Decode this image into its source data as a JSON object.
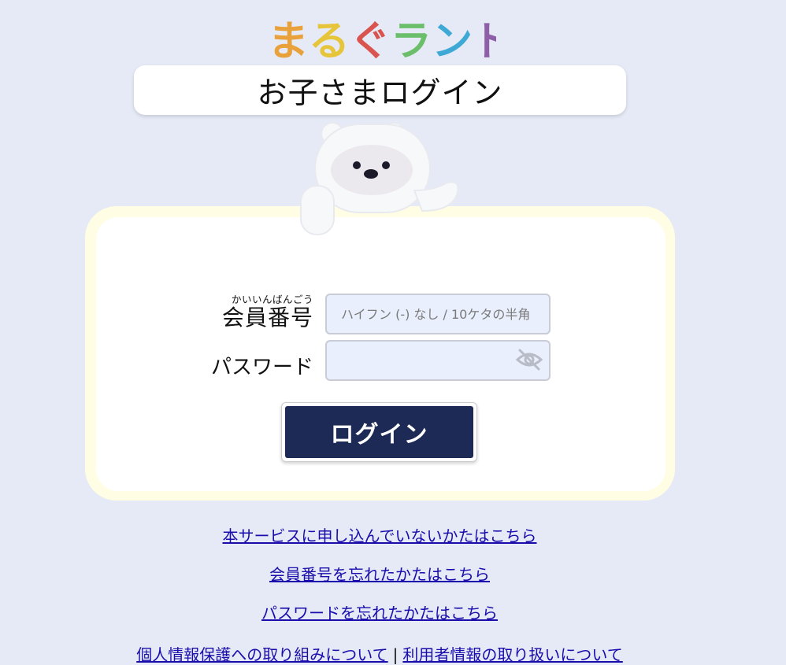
{
  "logo": {
    "text": "まるぐランド",
    "colors": [
      "#e9a23b",
      "#e7c53a",
      "#d9534f",
      "#6cbf6a",
      "#3fa9d6",
      "#8e5fa8"
    ]
  },
  "page": {
    "title": "お子さまログイン"
  },
  "form": {
    "member_number": {
      "ruby": "かいいんばんごう",
      "label": "会員番号",
      "placeholder": "ハイフン (-) なし / 10ケタの半角",
      "value": ""
    },
    "password": {
      "label": "パスワード",
      "value": "",
      "toggle_icon": "eye-slash-icon"
    },
    "login_label": "ログイン"
  },
  "links": {
    "signup": "本サービスに申し込んでいないかたはこちら",
    "forgot_member": "会員番号を忘れたかたはこちら",
    "forgot_password": "パスワードを忘れたかたはこちら"
  },
  "footer": {
    "privacy": "個人情報保護への取り組みについて",
    "separator": "|",
    "user_info": "利用者情報の取り扱いについて"
  },
  "colors": {
    "background": "#e5eaf6",
    "button": "#1d2a55",
    "card_border": "#fffde4",
    "link": "#1a0dab"
  }
}
